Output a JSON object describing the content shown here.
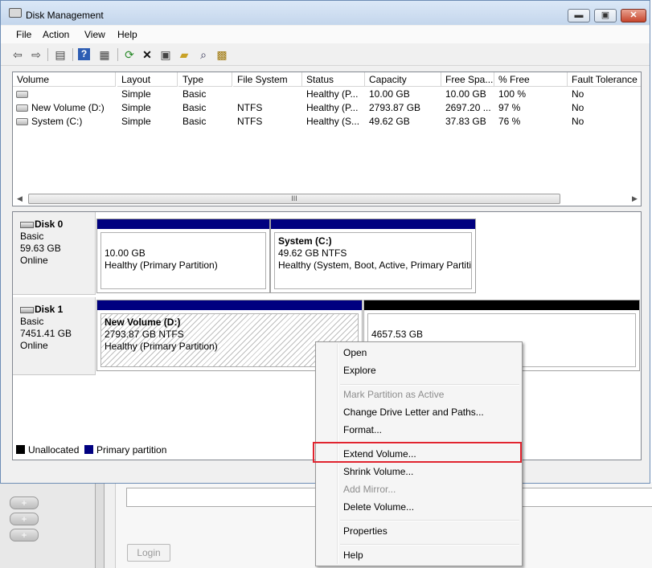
{
  "window": {
    "title": "Disk Management"
  },
  "menu": [
    "File",
    "Action",
    "View",
    "Help"
  ],
  "toolbar_icons": [
    "back-icon",
    "forward-icon",
    "up-list-icon",
    "help-icon",
    "properties-pane-icon",
    "refresh-icon",
    "delete-icon",
    "properties-icon",
    "open-icon",
    "explore-icon",
    "wizard-icon"
  ],
  "volume_list": {
    "columns": [
      "Volume",
      "Layout",
      "Type",
      "File System",
      "Status",
      "Capacity",
      "Free Spa...",
      "% Free",
      "Fault Tolerance"
    ],
    "rows": [
      {
        "volume": "",
        "layout": "Simple",
        "type": "Basic",
        "fs": "",
        "status": "Healthy (P...",
        "capacity": "10.00 GB",
        "free": "10.00 GB",
        "pct": "100 %",
        "fault": "No"
      },
      {
        "volume": "New Volume (D:)",
        "layout": "Simple",
        "type": "Basic",
        "fs": "NTFS",
        "status": "Healthy (P...",
        "capacity": "2793.87 GB",
        "free": "2697.20 ...",
        "pct": "97 %",
        "fault": "No"
      },
      {
        "volume": "System (C:)",
        "layout": "Simple",
        "type": "Basic",
        "fs": "NTFS",
        "status": "Healthy (S...",
        "capacity": "49.62 GB",
        "free": "37.83 GB",
        "pct": "76 %",
        "fault": "No"
      }
    ],
    "scroll_thumb_glyph": "III"
  },
  "disks": [
    {
      "name": "Disk 0",
      "type": "Basic",
      "size": "59.63 GB",
      "state": "Online",
      "partitions": [
        {
          "label": "",
          "size": "10.00 GB",
          "status": "Healthy (Primary Partition)"
        },
        {
          "label": "System  (C:)",
          "size": "49.62 GB NTFS",
          "status": "Healthy (System, Boot, Active, Primary Partiti"
        }
      ]
    },
    {
      "name": "Disk 1",
      "type": "Basic",
      "size": "7451.41 GB",
      "state": "Online",
      "partitions": [
        {
          "label": "New Volume  (D:)",
          "size": "2793.87 GB NTFS",
          "status": "Healthy (Primary Partition)"
        },
        {
          "label": "",
          "size": "4657.53 GB",
          "status": ""
        }
      ]
    }
  ],
  "legend": {
    "unallocated": "Unallocated",
    "primary": "Primary partition",
    "unallocated_color": "#000000",
    "primary_color": "#000080"
  },
  "context_menu": {
    "items": [
      {
        "label": "Open",
        "enabled": true
      },
      {
        "label": "Explore",
        "enabled": true
      },
      {
        "label": "Mark Partition as Active",
        "enabled": false
      },
      {
        "label": "Change Drive Letter and Paths...",
        "enabled": true
      },
      {
        "label": "Format...",
        "enabled": true
      },
      {
        "label": "Extend Volume...",
        "enabled": true,
        "highlighted": true
      },
      {
        "label": "Shrink Volume...",
        "enabled": true
      },
      {
        "label": "Add Mirror...",
        "enabled": false
      },
      {
        "label": "Delete Volume...",
        "enabled": true
      },
      {
        "label": "Properties",
        "enabled": true
      },
      {
        "label": "Help",
        "enabled": true
      }
    ],
    "highlight_color": "#e0242f"
  },
  "background_app": {
    "login_label": "Login",
    "plus_glyph": "+"
  }
}
